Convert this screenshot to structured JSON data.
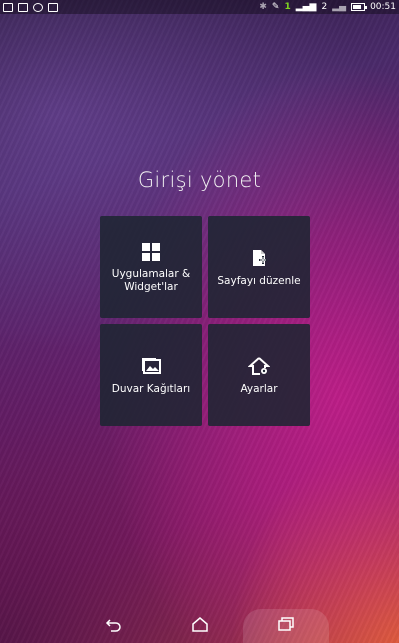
{
  "status_bar": {
    "time": "00:51",
    "signal_badge": "1",
    "sim_badge": "2",
    "left_icons": [
      "gallery-icon",
      "mail-icon",
      "chat-icon",
      "shopping-icon"
    ],
    "right_icons": [
      "bluetooth-icon",
      "mute-icon",
      "sim1-icon",
      "signal-icon",
      "sim2-icon",
      "wifi-signal-icon",
      "battery-icon"
    ]
  },
  "home_manage": {
    "title": "Girişi yönet",
    "tiles": [
      {
        "label": "Uygulamalar & Widget'lar",
        "icon": "apps-grid-icon"
      },
      {
        "label": "Sayfayı düzenle",
        "icon": "edit-page-icon"
      },
      {
        "label": "Duvar Kağıtları",
        "icon": "wallpaper-icon"
      },
      {
        "label": "Ayarlar",
        "icon": "home-settings-icon"
      }
    ]
  },
  "navigation": {
    "buttons": [
      "back-icon",
      "home-icon",
      "recent-apps-icon"
    ]
  }
}
